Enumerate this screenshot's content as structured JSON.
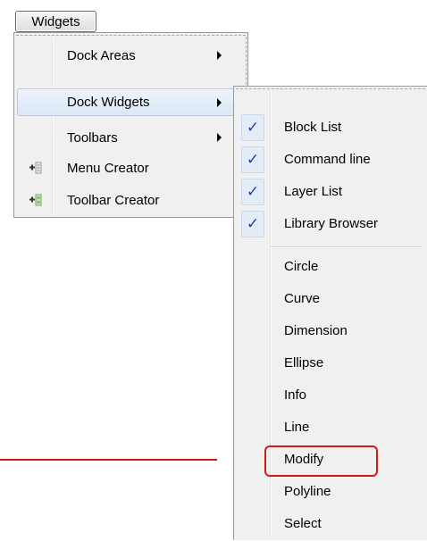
{
  "menubar": {
    "widgets_label": "Widgets"
  },
  "widgets_menu": {
    "items": [
      {
        "label": "Dock Areas",
        "has_submenu": true,
        "icon": ""
      },
      {
        "label": "Dock Widgets",
        "has_submenu": true,
        "highlighted": true,
        "icon": ""
      },
      {
        "label": "Toolbars",
        "has_submenu": true,
        "icon": ""
      },
      {
        "label": "Menu Creator",
        "has_submenu": false,
        "icon": "add-menu-icon"
      },
      {
        "label": "Toolbar Creator",
        "has_submenu": false,
        "icon": "add-toolbar-icon"
      }
    ]
  },
  "dock_widgets_menu": {
    "checked_items": [
      {
        "label": "Block List",
        "checked": true
      },
      {
        "label": "Command line",
        "checked": true
      },
      {
        "label": "Layer List",
        "checked": true
      },
      {
        "label": "Library Browser",
        "checked": true
      }
    ],
    "check_glyph": "✓",
    "tool_items": [
      {
        "label": "Circle"
      },
      {
        "label": "Curve"
      },
      {
        "label": "Dimension"
      },
      {
        "label": "Ellipse"
      },
      {
        "label": "Info"
      },
      {
        "label": "Line"
      },
      {
        "label": "Modify",
        "annotated": true
      },
      {
        "label": "Polyline"
      },
      {
        "label": "Select"
      }
    ]
  },
  "colors": {
    "annotation": "#d11a1a",
    "check": "#1b3fc4",
    "highlight": "#dbe7f6"
  }
}
